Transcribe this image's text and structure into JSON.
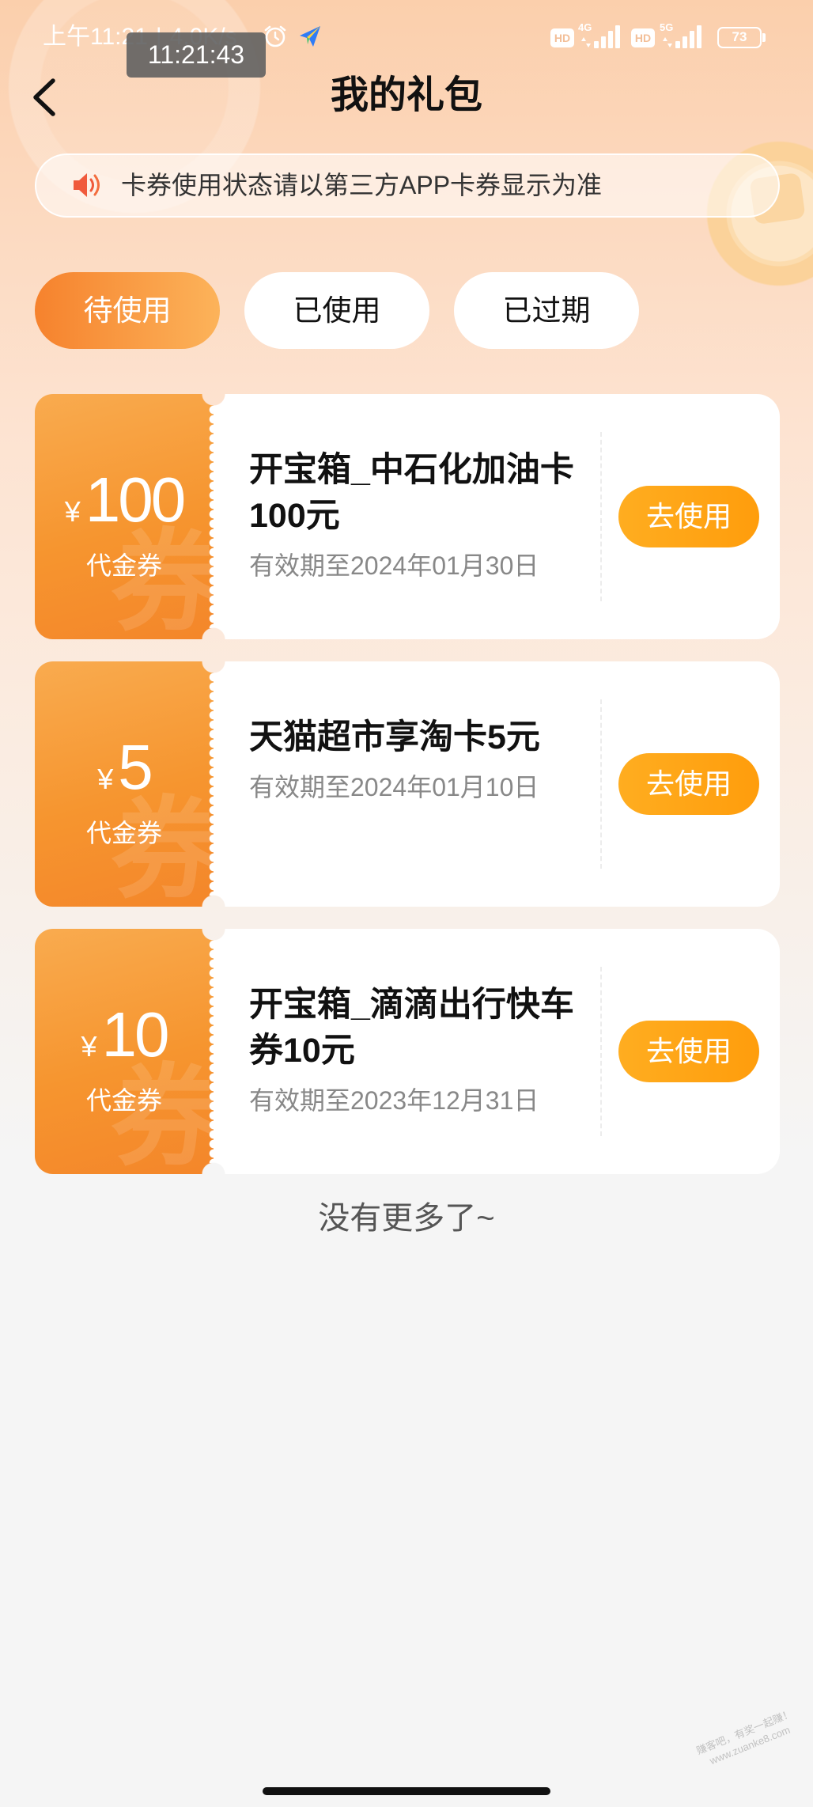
{
  "status_bar": {
    "time": "上午11:21",
    "separator": "|",
    "net_speed": "4.0K/s",
    "overlay_time": "11:21:43",
    "alarm_icon": "alarm-clock-icon",
    "app_icon": "paper-plane-app-icon",
    "hd_badge_1": "HD",
    "network_1": "4G",
    "hd_badge_2": "HD",
    "network_2": "5G",
    "battery_level": "73"
  },
  "header": {
    "back_icon": "chevron-left-icon",
    "title": "我的礼包"
  },
  "notice": {
    "icon": "speaker-icon",
    "text": "卡券使用状态请以第三方APP卡券显示为准"
  },
  "tabs": [
    {
      "label": "待使用",
      "active": true
    },
    {
      "label": "已使用",
      "active": false
    },
    {
      "label": "已过期",
      "active": false
    }
  ],
  "coupons": [
    {
      "currency": "¥",
      "amount": "100",
      "type": "代金券",
      "watermark": "券",
      "title": "开宝箱_中石化加油卡100元",
      "expiry": "有效期至2024年01月30日",
      "action": "去使用"
    },
    {
      "currency": "¥",
      "amount": "5",
      "type": "代金券",
      "watermark": "券",
      "title": "天猫超市享淘卡5元",
      "expiry": "有效期至2024年01月10日",
      "action": "去使用"
    },
    {
      "currency": "¥",
      "amount": "10",
      "type": "代金券",
      "watermark": "券",
      "title": "开宝箱_滴滴出行快车券10元",
      "expiry": "有效期至2023年12月31日",
      "action": "去使用"
    }
  ],
  "list_end": {
    "text": "没有更多了~"
  },
  "watermark": {
    "line1": "赚客吧，有奖一起赚！",
    "line2": "www.zuanke8.com"
  },
  "colors": {
    "accent_orange": "#f58a2f",
    "button_orange": "#ffa31a",
    "notice_icon": "#f05a3c",
    "text_primary": "#111111",
    "text_secondary": "#888888",
    "page_bg": "#f5f5f5"
  }
}
